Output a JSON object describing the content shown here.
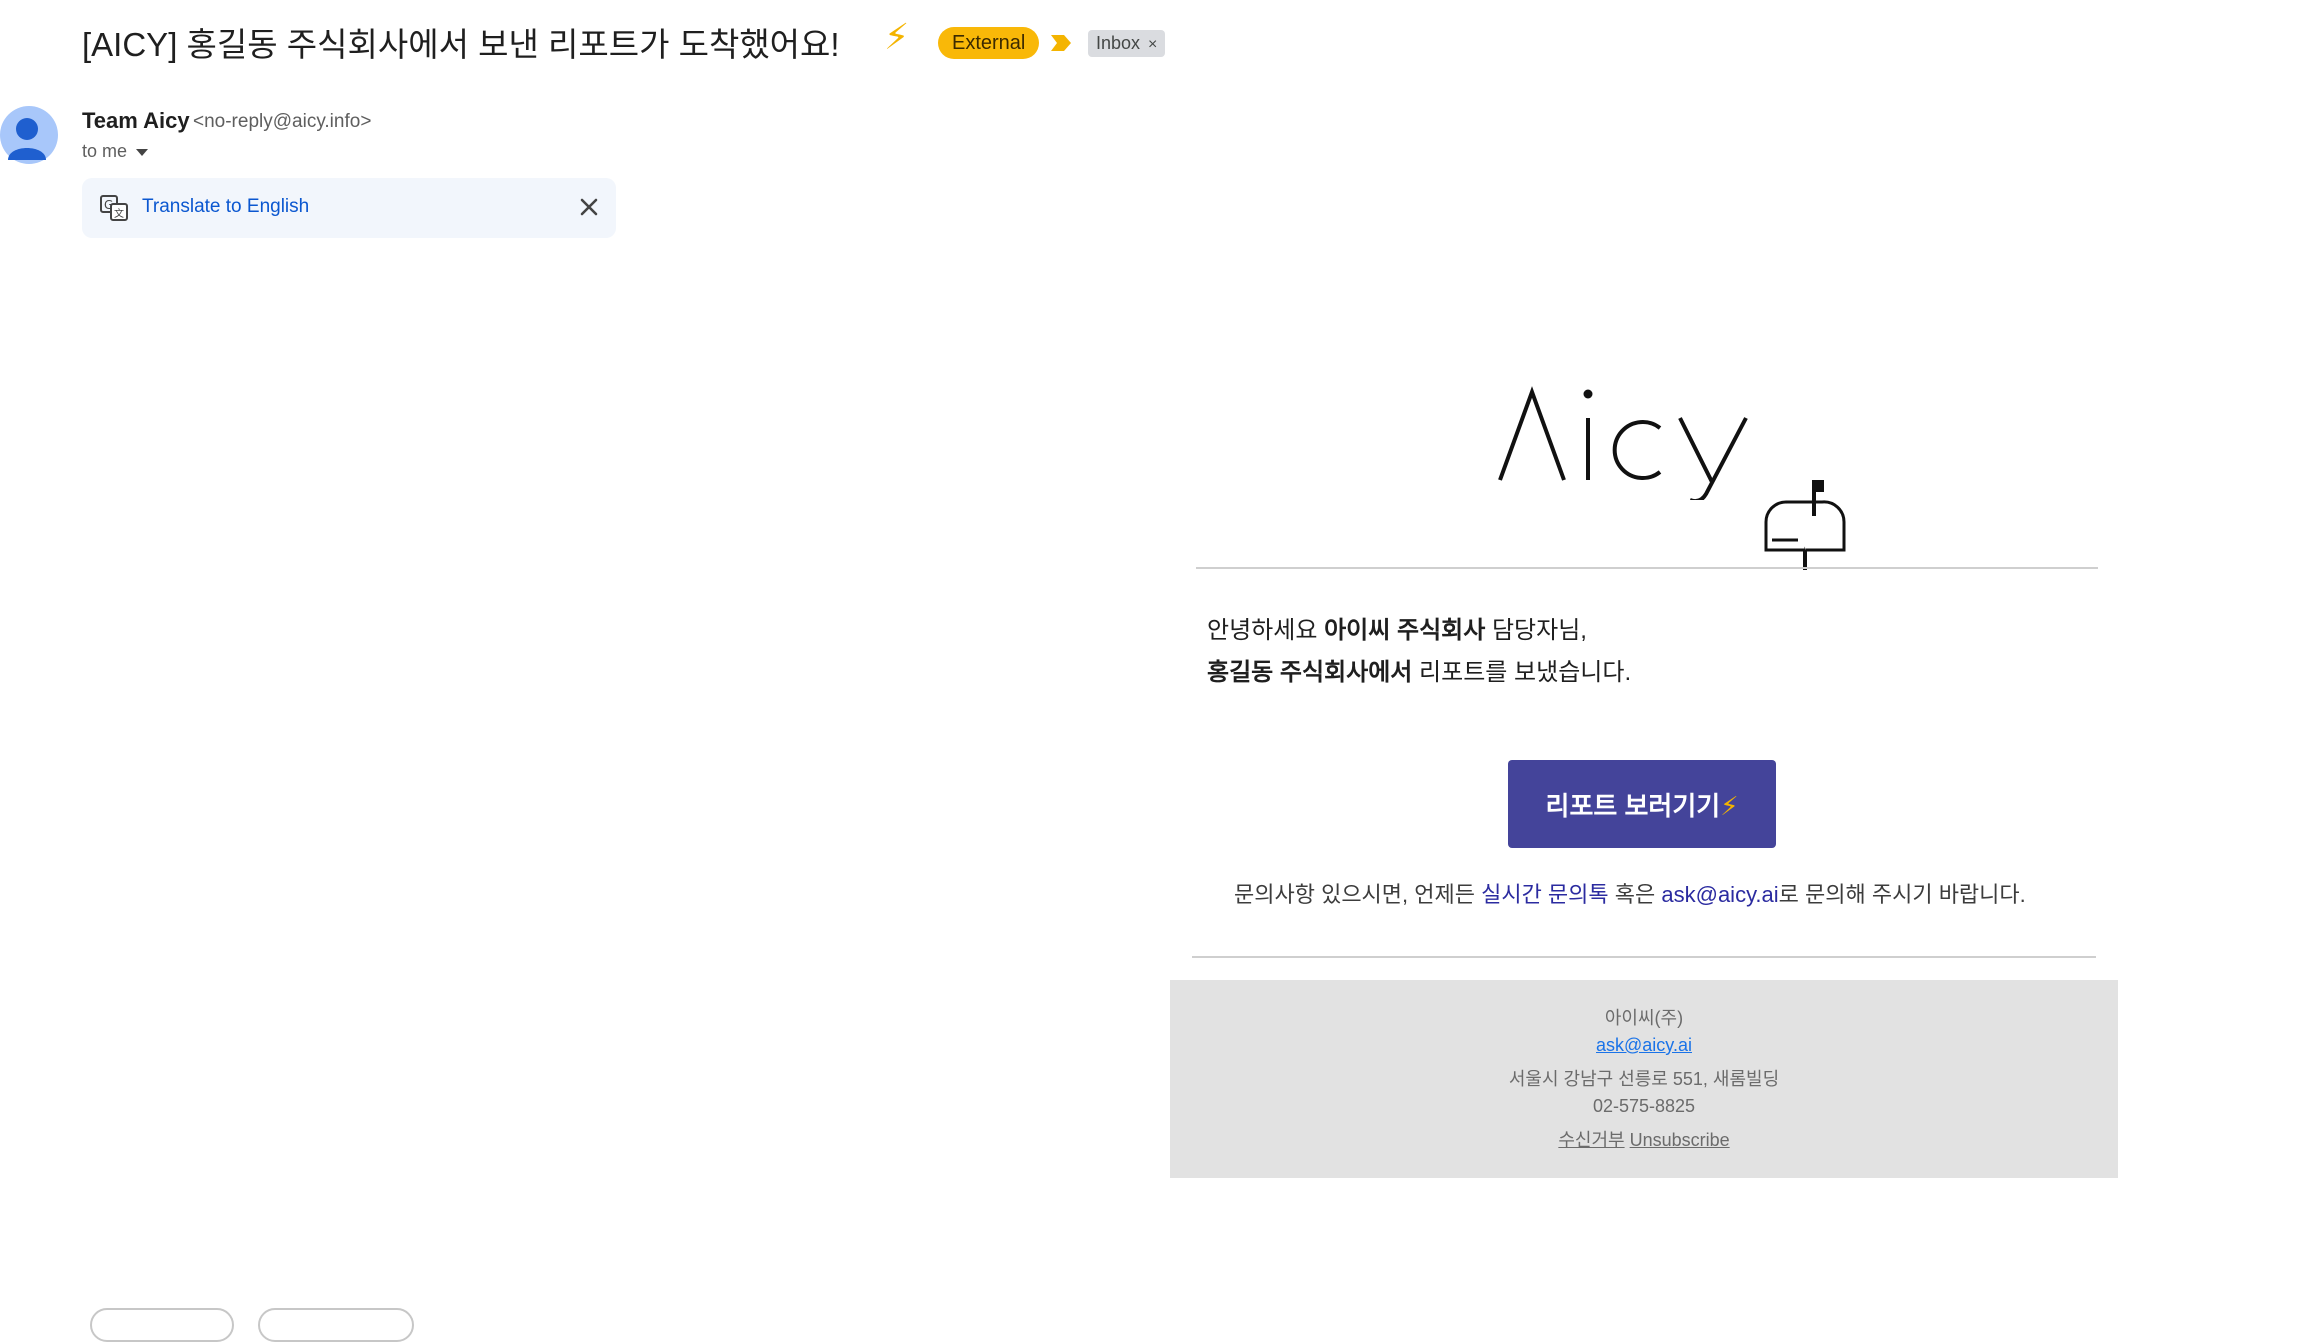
{
  "header": {
    "subject": "[AICY] 홍길동 주식회사에서 보낸 리포트가 도착했어요!",
    "subject_emoji": "⚡",
    "external_badge": "External",
    "inbox_label": "Inbox",
    "inbox_remove": "×"
  },
  "sender": {
    "name": "Team Aicy",
    "email": "<no-reply@aicy.info>",
    "to": "to me"
  },
  "translate": {
    "link": "Translate to English"
  },
  "email": {
    "logo_text": "Λicy",
    "greeting_prefix": "안녕하세요 ",
    "greeting_company": "아이씨 주식회사",
    "greeting_suffix": " 담당자님,",
    "sender_company": "홍길동 주식회사에서",
    "sender_suffix": " 리포트를 보냈습니다.",
    "cta_label": "리포트 보러기기",
    "cta_emoji": "⚡",
    "inquiry_prefix": "문의사항 있으시면, 언제든 ",
    "inquiry_link": "실시간 문의톡",
    "inquiry_middle": " 혹은 ",
    "inquiry_email": "ask@aicy.ai",
    "inquiry_suffix": "로 문의해 주시기 바랍니다."
  },
  "footer": {
    "company": "아이씨(주)",
    "email": "ask@aicy.ai",
    "address": "서울시 강남구 선릉로 551, 새롬빌딩",
    "phone": "02-575-8825",
    "unsubscribe_ko": "수신거부",
    "unsubscribe_en": "Unsubscribe"
  },
  "colors": {
    "cta_bg": "#44449a",
    "external_badge": "#f9b808",
    "footer_bg": "#e2e2e2",
    "link": "#2b2ba0"
  },
  "icons": {
    "avatar": "person-avatar-icon",
    "important": "importance-marker-icon",
    "translate": "translate-icon",
    "close": "close-icon",
    "dropdown": "chevron-down-icon",
    "mailbox": "mailbox-icon"
  }
}
